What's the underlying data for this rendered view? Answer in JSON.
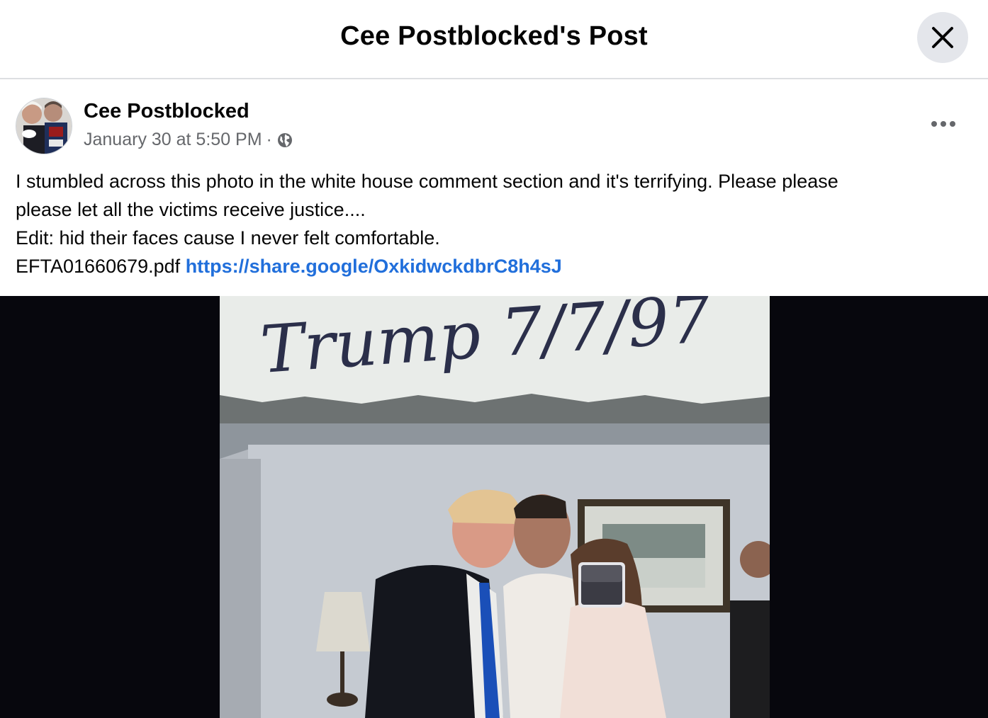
{
  "dialog": {
    "title": "Cee Postblocked's Post"
  },
  "post": {
    "author": "Cee Postblocked",
    "timestamp": "January 30 at 5:50 PM",
    "separator": "·",
    "audience_icon": "globe-icon",
    "more_icon": "more-horizontal-icon",
    "text_lines": [
      "I stumbled across this photo in the white house comment section and it's terrifying. Please please",
      "please let all the victims receive justice....",
      "Edit: hid their faces cause I never felt comfortable."
    ],
    "attachment_filename": "EFTA01660679.pdf",
    "link": "https://share.google/OxkidwckdbrC8h4sJ",
    "photo_caption": "Trump 7/7/97"
  },
  "colors": {
    "link": "#216fdb",
    "meta": "#65676b",
    "close_bg": "#e4e6eb",
    "media_bg": "#07070d"
  }
}
